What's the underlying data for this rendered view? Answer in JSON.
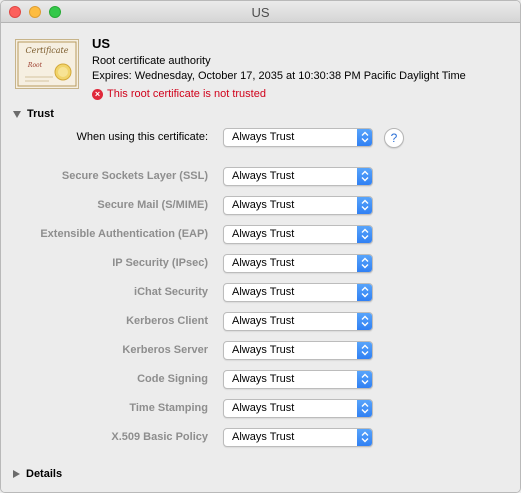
{
  "window": {
    "title": "US"
  },
  "certificate": {
    "name": "US",
    "kind": "Root certificate authority",
    "expires": "Expires: Wednesday, October 17, 2035 at 10:30:38 PM Pacific Daylight Time",
    "status": "This root certificate is not trusted",
    "icon_text": "Certificate",
    "icon_subtext": "Root"
  },
  "trust": {
    "section_label": "Trust",
    "when_using": {
      "label": "When using this certificate:",
      "value": "Always Trust"
    },
    "help_label": "?",
    "policies": [
      {
        "label": "Secure Sockets Layer (SSL)",
        "value": "Always Trust"
      },
      {
        "label": "Secure Mail (S/MIME)",
        "value": "Always Trust"
      },
      {
        "label": "Extensible Authentication (EAP)",
        "value": "Always Trust"
      },
      {
        "label": "IP Security (IPsec)",
        "value": "Always Trust"
      },
      {
        "label": "iChat Security",
        "value": "Always Trust"
      },
      {
        "label": "Kerberos Client",
        "value": "Always Trust"
      },
      {
        "label": "Kerberos Server",
        "value": "Always Trust"
      },
      {
        "label": "Code Signing",
        "value": "Always Trust"
      },
      {
        "label": "Time Stamping",
        "value": "Always Trust"
      },
      {
        "label": "X.509 Basic Policy",
        "value": "Always Trust"
      }
    ]
  },
  "details": {
    "section_label": "Details"
  },
  "icons": {
    "close": "close-icon",
    "minimize": "minimize-icon",
    "zoom": "zoom-icon",
    "certificate": "certificate-icon",
    "error": "error-circle-icon",
    "disclosure_open": "disclosure-down-icon",
    "disclosure_closed": "disclosure-right-icon",
    "popup": "updown-chevron-icon"
  },
  "colors": {
    "error": "#d0021b",
    "accent": "#2e7ef3"
  }
}
